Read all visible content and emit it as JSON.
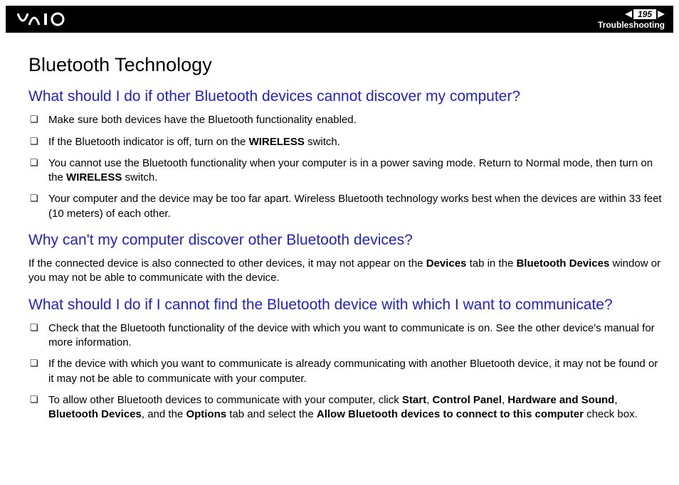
{
  "header": {
    "page_number": "195",
    "section": "Troubleshooting"
  },
  "title": "Bluetooth Technology",
  "q1": {
    "heading": "What should I do if other Bluetooth devices cannot discover my computer?",
    "items": [
      {
        "pre": "Make sure both devices have the Bluetooth functionality enabled."
      },
      {
        "pre": "If the Bluetooth indicator is off, turn on the ",
        "b1": "WIRELESS",
        "post": " switch."
      },
      {
        "pre": "You cannot use the Bluetooth functionality when your computer is in a power saving mode. Return to Normal mode, then turn on the ",
        "b1": "WIRELESS",
        "post": " switch."
      },
      {
        "pre": "Your computer and the device may be too far apart. Wireless Bluetooth technology works best when the devices are within 33 feet (10 meters) of each other."
      }
    ]
  },
  "q2": {
    "heading": "Why can't my computer discover other Bluetooth devices?",
    "para_pre": "If the connected device is also connected to other devices, it may not appear on the ",
    "para_b1": "Devices",
    "para_mid1": " tab in the ",
    "para_b2": "Bluetooth Devices",
    "para_post": " window or you may not be able to communicate with the device."
  },
  "q3": {
    "heading": "What should I do if I cannot find the Bluetooth device with which I want to communicate?",
    "items": [
      {
        "pre": "Check that the Bluetooth functionality of the device with which you want to communicate is on. See the other device's manual for more information."
      },
      {
        "pre": "If the device with which you want to communicate is already communicating with another Bluetooth device, it may not be found or it may not be able to communicate with your computer."
      },
      {
        "pre": "To allow other Bluetooth devices to communicate with your computer, click ",
        "b1": "Start",
        "s1": ", ",
        "b2": "Control Panel",
        "s2": ", ",
        "b3": "Hardware and Sound",
        "s3": ", ",
        "b4": "Bluetooth Devices",
        "s4": ", and the ",
        "b5": "Options",
        "s5": " tab and select the ",
        "b6": "Allow Bluetooth devices to connect to this computer",
        "s6": " check box."
      }
    ]
  }
}
